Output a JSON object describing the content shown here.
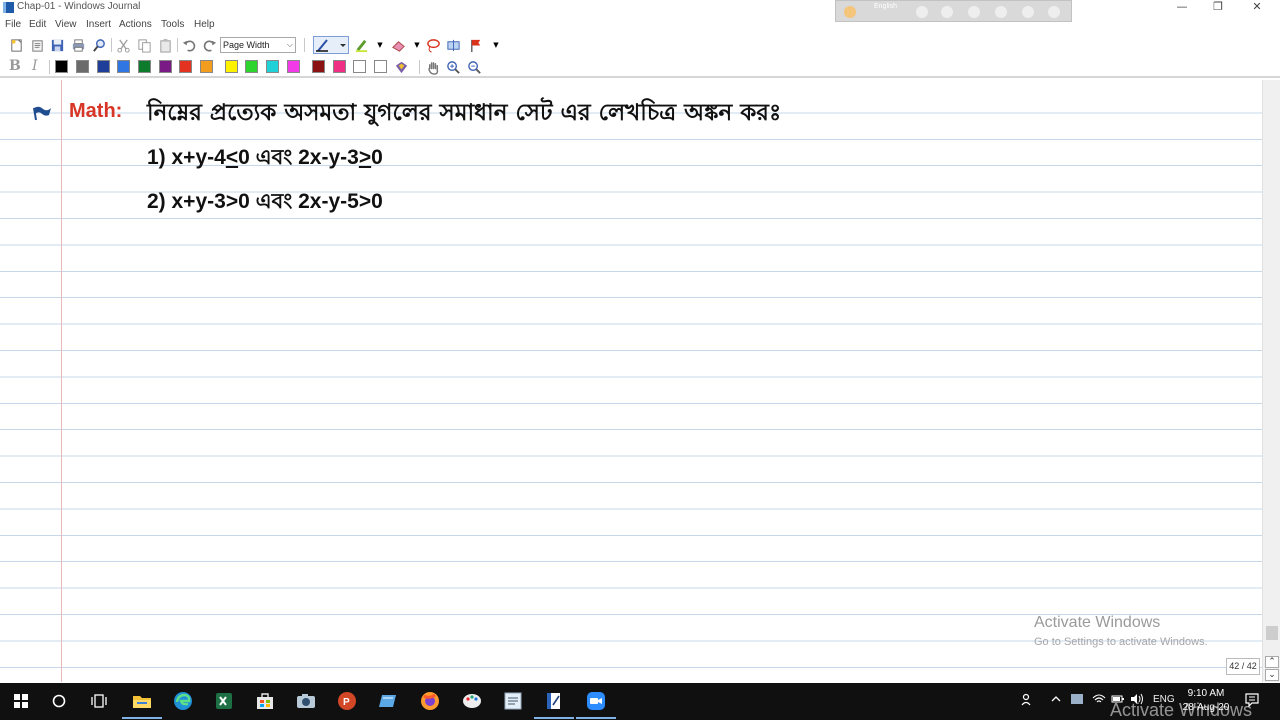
{
  "window": {
    "title": "Chap-01 - Windows Journal"
  },
  "overlay": {
    "language": "English"
  },
  "menu": {
    "items": [
      "File",
      "Edit",
      "View",
      "Insert",
      "Actions",
      "Tools",
      "Help"
    ]
  },
  "toolbar": {
    "zoom_value": "Page Width",
    "format_bold": "B",
    "format_italic": "I",
    "swatches": [
      "#000000",
      "#6b6b6b",
      "#1f3e9a",
      "#2f76e3",
      "#0e7a2b",
      "#7a1a84",
      "#e3321f",
      "#f39d1e",
      "#fff200",
      "#2dd42d",
      "#20d1d8",
      "#f23ae8",
      "#8a1212",
      "#f02f84",
      "#ffffff",
      "#ffffff"
    ]
  },
  "note": {
    "subject_label": "Math:",
    "heading": "নিম্নের প্রত্যেক অসমতা যুগলের সমাধান সেট এর লেখচিত্র অঙ্কন করঃ",
    "lines": [
      {
        "prefix": "1) x+y-4",
        "op1": "<",
        "mid": "0 এবং 2x-y-3",
        "op2": ">",
        "suffix": "0",
        "underline_ops": true
      },
      {
        "prefix": "2) x+y-3",
        "op1": ">",
        "mid": "0 এবং 2x-y-5",
        "op2": ">",
        "suffix": "0",
        "underline_ops": false
      }
    ]
  },
  "status": {
    "page_count": "42 / 42"
  },
  "watermark": {
    "title": "Activate Windows",
    "subtitle": "Go to Settings to activate Windows."
  },
  "taskbar": {
    "tray_lang": "ENG",
    "time": "9:10 AM",
    "date": "28-Aug-20",
    "overlay_watermark": "Activate Windows"
  }
}
